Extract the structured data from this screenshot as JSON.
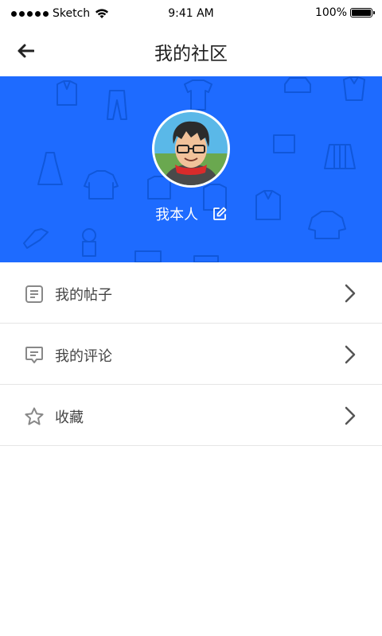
{
  "status_bar": {
    "carrier": "Sketch",
    "time": "9:41 AM",
    "battery": "100%"
  },
  "nav": {
    "title": "我的社区"
  },
  "profile": {
    "username": "我本人",
    "banner_color": "#1e6bff"
  },
  "menu": {
    "items": [
      {
        "label": "我的帖子",
        "icon": "document-icon"
      },
      {
        "label": "我的评论",
        "icon": "comment-icon"
      },
      {
        "label": "收藏",
        "icon": "star-icon"
      }
    ]
  }
}
